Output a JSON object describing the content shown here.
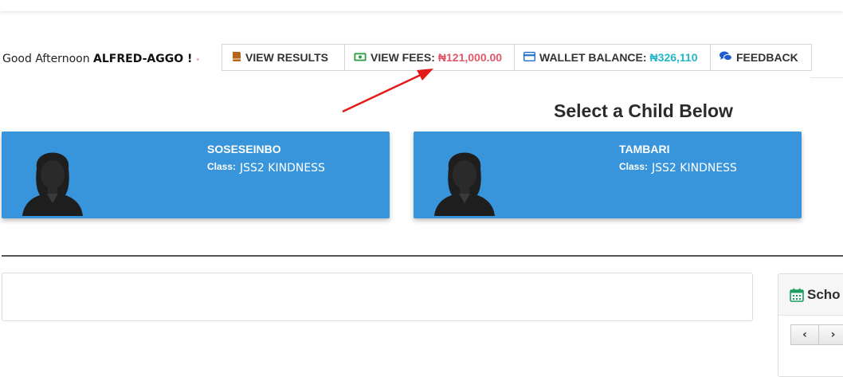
{
  "greeting": {
    "prefix": "Good Afternoon",
    "name": "ALFRED-AGGO !"
  },
  "toolbar": {
    "results_label": "VIEW RESULTS",
    "fees_label": "VIEW FEES:",
    "fees_amount": "₦121,000.00",
    "wallet_label": "WALLET BALANCE:",
    "wallet_amount": "₦326,110",
    "feedback_label": "FEEDBACK",
    "icons": [
      "book-icon",
      "money-icon",
      "credit-card-icon",
      "comments-icon"
    ]
  },
  "section_title": "Select a Child Below",
  "children": [
    {
      "name": "SOSESEINBO",
      "class_label": "Class:",
      "class_value": "JSS2 KINDNESS"
    },
    {
      "name": "TAMBARI",
      "class_label": "Class:",
      "class_value": "JSS2 KINDNESS"
    }
  ],
  "calendar_panel": {
    "title": "Scho",
    "prev_label": "‹",
    "next_label": "›"
  },
  "colors": {
    "card_bg": "#3895db",
    "fees_amount": "#e25869",
    "wallet_amount": "#22b6c8",
    "annotation_arrow": "#e31b1b"
  }
}
